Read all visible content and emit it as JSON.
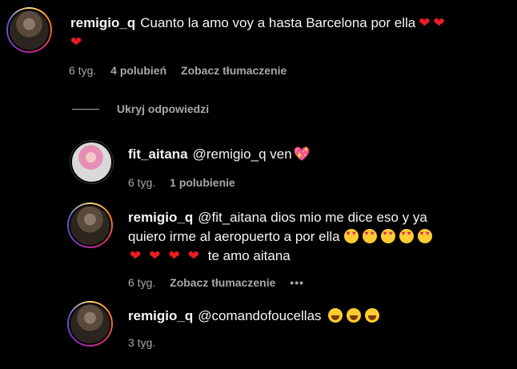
{
  "comments": [
    {
      "username": "remigio_q",
      "text": "Cuanto la amo voy a hasta Barcelona por ella",
      "time": "6 tyg.",
      "likes": "4 polubień",
      "translate": "Zobacz tłumaczenie"
    },
    {
      "username": "fit_aitana",
      "text": "@remigio_q ven",
      "time": "6 tyg.",
      "likes": "1 polubienie"
    },
    {
      "username": "remigio_q",
      "text_line1": "@fit_aitana dios mio me dice eso y ya",
      "text_line2": "quiero irme al aeropuerto a por ella",
      "text_line3": "te amo aitana",
      "time": "6 tyg.",
      "translate": "Zobacz tłumaczenie",
      "more": "•••"
    },
    {
      "username": "remigio_q",
      "text": "@comandofoucellas",
      "time": "3 tyg."
    }
  ],
  "hide_replies": "Ukryj odpowiedzi",
  "colors": {
    "background": "#000000",
    "text": "#f5f5f5",
    "muted": "#a8a8a8",
    "heart": "#ed1c24"
  },
  "icons": [
    "heart-emoji",
    "heart-eyes-emoji",
    "sparkling-heart-emoji",
    "laughing-emoji",
    "more-icon"
  ]
}
